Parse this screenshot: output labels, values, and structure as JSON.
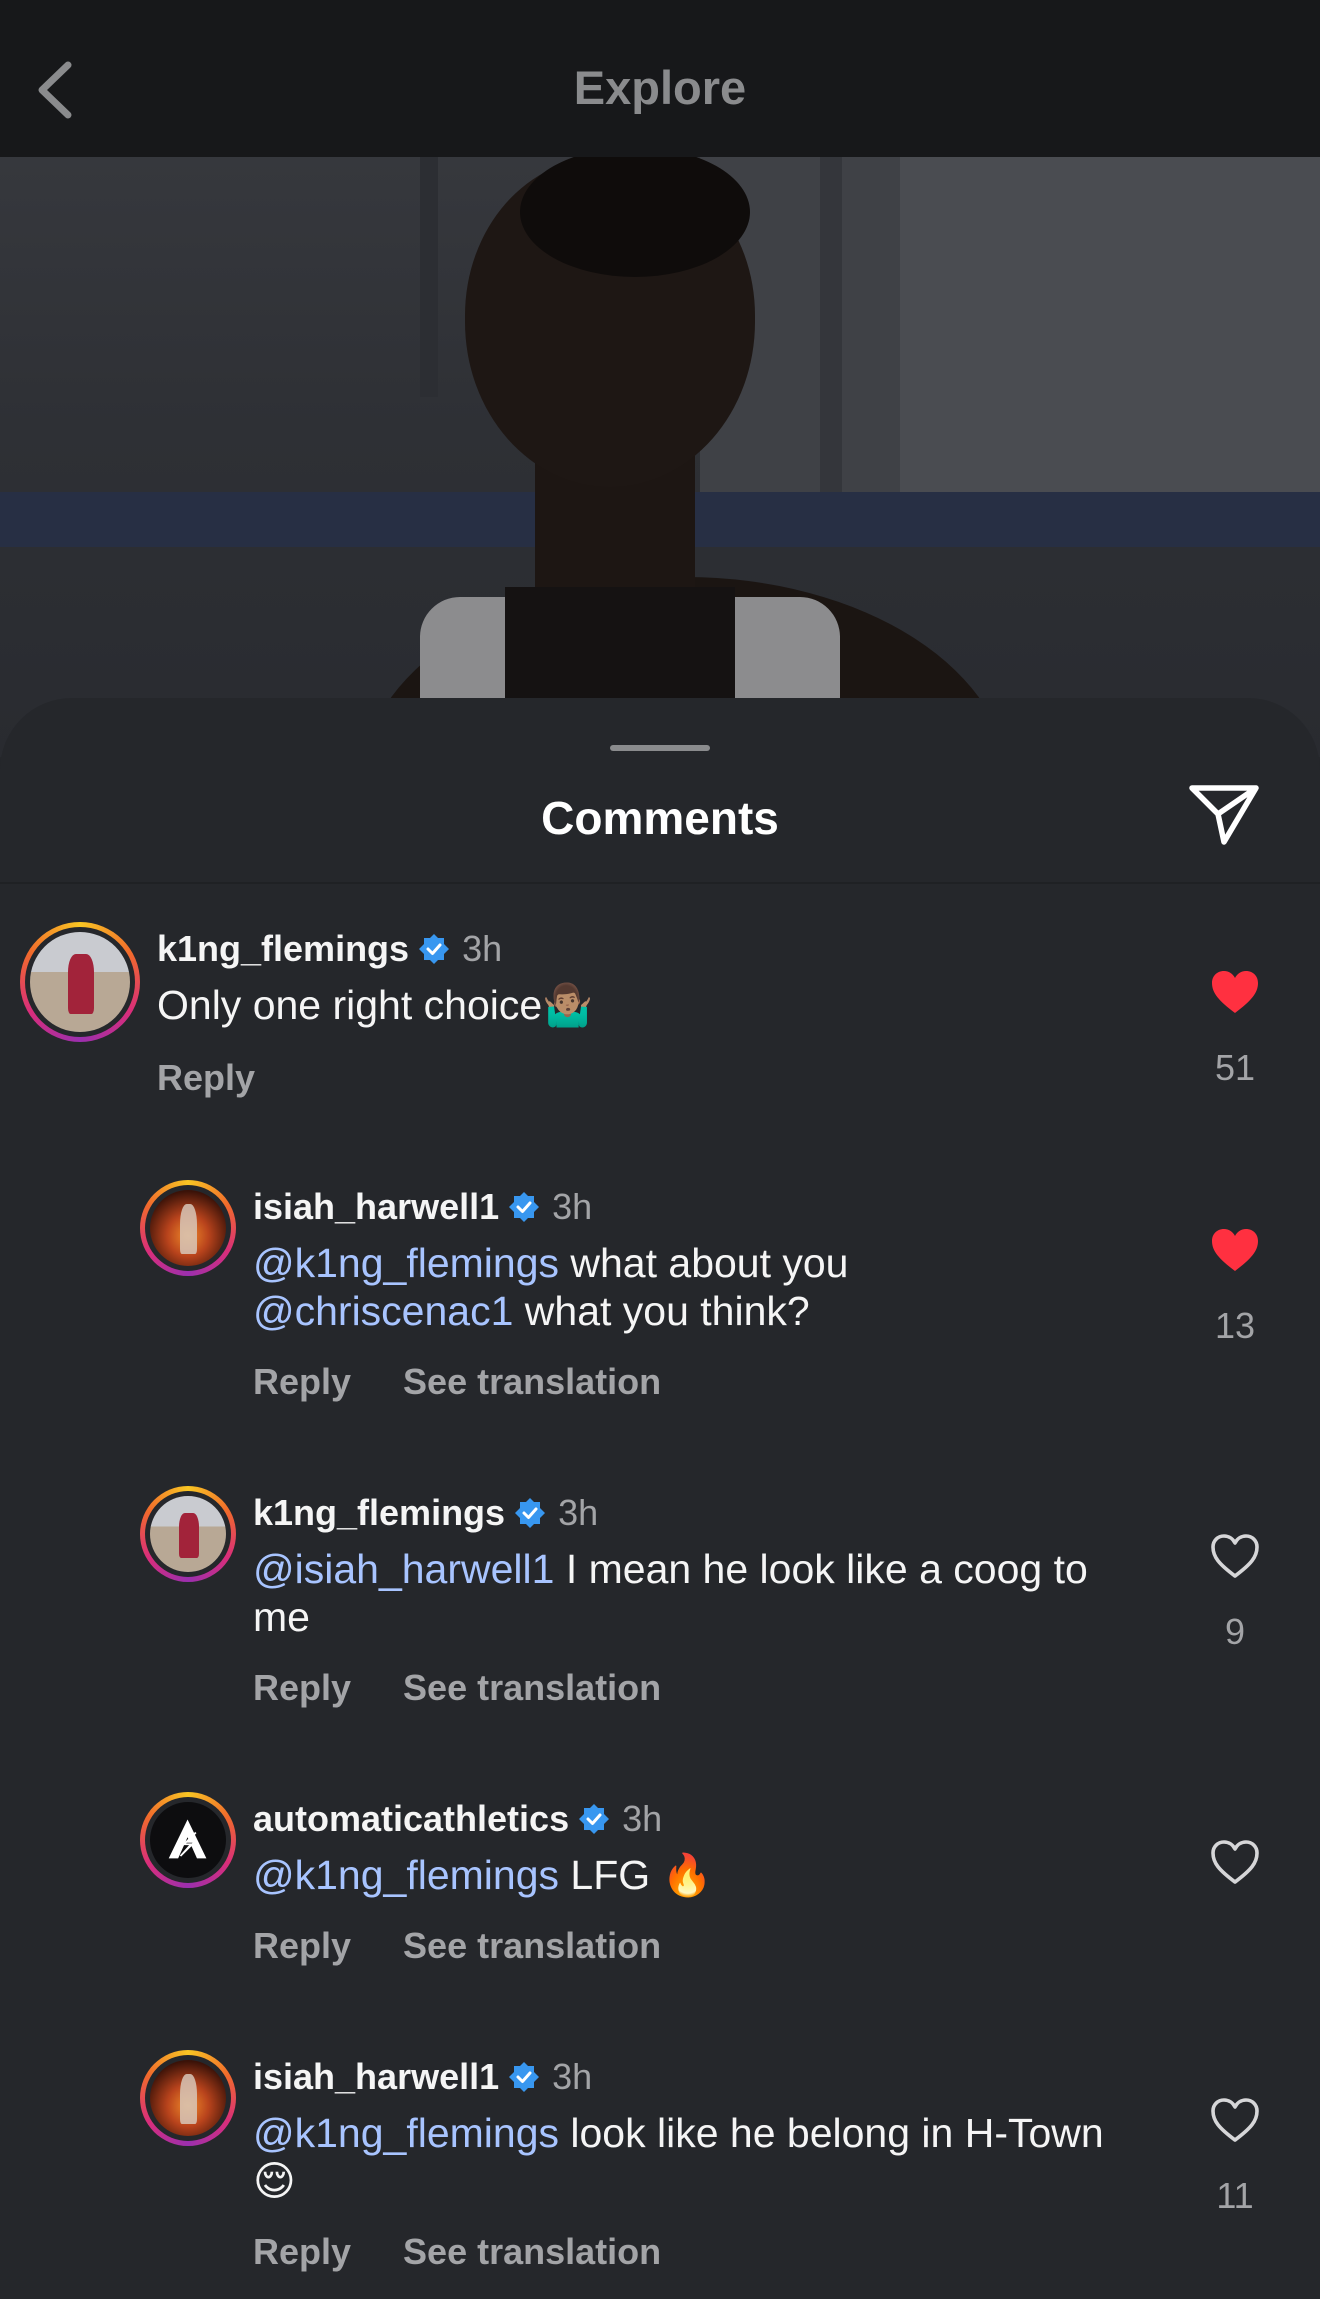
{
  "nav": {
    "title": "Explore",
    "back_icon": "chevron-left-icon"
  },
  "sheet": {
    "title": "Comments",
    "share_icon": "send-icon"
  },
  "colors": {
    "background": "#25272b",
    "mention": "#a8c4ff",
    "verified": "#3897f0",
    "liked": "#ff3040",
    "muted": "#a3a4a7"
  },
  "comments": [
    {
      "username": "k1ng_flemings",
      "verified": true,
      "time": "3h",
      "text": "Only one right choice",
      "emoji": "🤷🏽‍♂️",
      "reply_label": "Reply",
      "likes": "51",
      "liked": true
    },
    {
      "username": "isiah_harwell1",
      "verified": true,
      "time": "3h",
      "mention1": "@k1ng_flemings",
      "text1": " what about you",
      "mention2": "@chriscenac1",
      "text2": " what you think?",
      "reply_label": "Reply",
      "translate_label": "See translation",
      "likes": "13",
      "liked": true
    },
    {
      "username": "k1ng_flemings",
      "verified": true,
      "time": "3h",
      "mention1": "@isiah_harwell1",
      "text1": " I mean he look like a coog to",
      "text2": "me",
      "reply_label": "Reply",
      "translate_label": "See translation",
      "likes": "9",
      "liked": false
    },
    {
      "username": "automaticathletics",
      "verified": true,
      "time": "3h",
      "mention1": "@k1ng_flemings",
      "text1": " LFG ",
      "emoji": "🔥",
      "reply_label": "Reply",
      "translate_label": "See translation",
      "likes": "",
      "liked": false
    },
    {
      "username": "isiah_harwell1",
      "verified": true,
      "time": "3h",
      "mention1": "@k1ng_flemings",
      "text1": " look like he belong in H-Town",
      "emoji": "😌",
      "reply_label": "Reply",
      "translate_label": "See translation",
      "likes": "11",
      "liked": false
    }
  ]
}
